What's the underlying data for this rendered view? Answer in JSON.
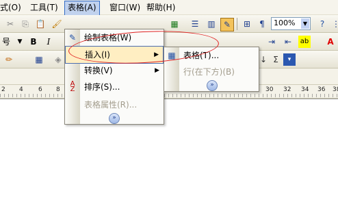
{
  "menubar": {
    "items": [
      {
        "label": "式(O)"
      },
      {
        "label": "工具(T)"
      },
      {
        "label": "表格(A)"
      },
      {
        "label": "窗口(W)"
      },
      {
        "label": "帮助(H)"
      }
    ]
  },
  "toolbar": {
    "zoom_value": "100%",
    "font_size_partial": "号",
    "bold_label": "B",
    "italic_label": "I"
  },
  "ruler": {
    "ticks": [
      "2",
      "4",
      "6",
      "8",
      "30",
      "32",
      "34",
      "36",
      "38"
    ]
  },
  "table_menu": {
    "items": [
      {
        "label": "绘制表格(W)",
        "icon": "pencil-icon",
        "enabled": true
      },
      {
        "label": "插入(I)",
        "icon": "",
        "enabled": true,
        "submenu": true,
        "highlighted": true
      },
      {
        "label": "转换(V)",
        "icon": "",
        "enabled": true,
        "submenu": true
      },
      {
        "label": "排序(S)...",
        "icon": "sort-az-icon",
        "enabled": true
      },
      {
        "label": "表格属性(R)...",
        "icon": "",
        "enabled": false
      }
    ],
    "expand_glyph": "»"
  },
  "insert_submenu": {
    "items": [
      {
        "label": "表格(T)...",
        "icon": "table-icon",
        "enabled": true
      },
      {
        "label": "行(在下方)(B)",
        "icon": "",
        "enabled": false
      }
    ],
    "expand_glyph": "»"
  },
  "colors": {
    "menu_highlight": "#ffeec2",
    "menu_highlight_border": "#4b6db0",
    "annotation": "#e02020"
  }
}
